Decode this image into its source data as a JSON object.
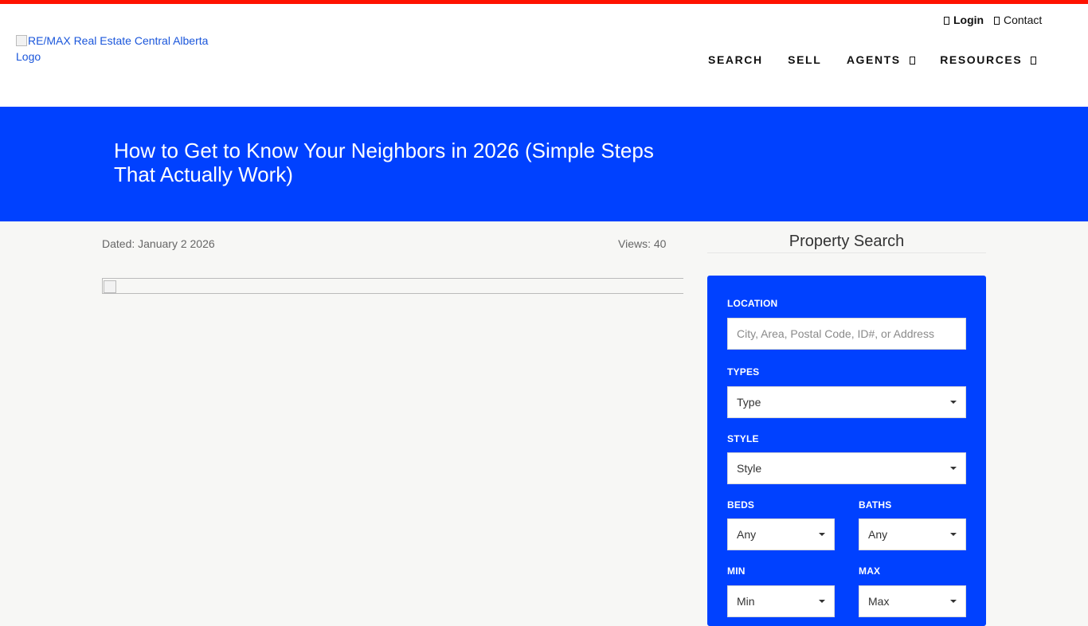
{
  "header": {
    "logo_alt": "RE/MAX Real Estate Central Alberta Logo",
    "utility": {
      "login": "Login",
      "contact": "Contact"
    },
    "nav": [
      {
        "label": "SEARCH"
      },
      {
        "label": "SELL"
      },
      {
        "label": "AGENTS"
      },
      {
        "label": "RESOURCES"
      }
    ]
  },
  "colors": {
    "accent_red": "#ff1200",
    "brand_blue": "#0041ff"
  },
  "hero": {
    "title": "How to Get to Know Your Neighbors in 2026 (Simple Steps That Actually Work)"
  },
  "article": {
    "dated": "Dated: January 2 2026",
    "views": "Views: 40"
  },
  "sidebar": {
    "title": "Property Search",
    "location": {
      "label": "LOCATION",
      "placeholder": "City, Area, Postal Code, ID#, or Address"
    },
    "types": {
      "label": "TYPES",
      "value": "Type"
    },
    "style": {
      "label": "STYLE",
      "value": "Style"
    },
    "beds": {
      "label": "BEDS",
      "value": "Any"
    },
    "baths": {
      "label": "BATHS",
      "value": "Any"
    },
    "min": {
      "label": "MIN",
      "value": "Min"
    },
    "max": {
      "label": "MAX",
      "value": "Max"
    }
  }
}
